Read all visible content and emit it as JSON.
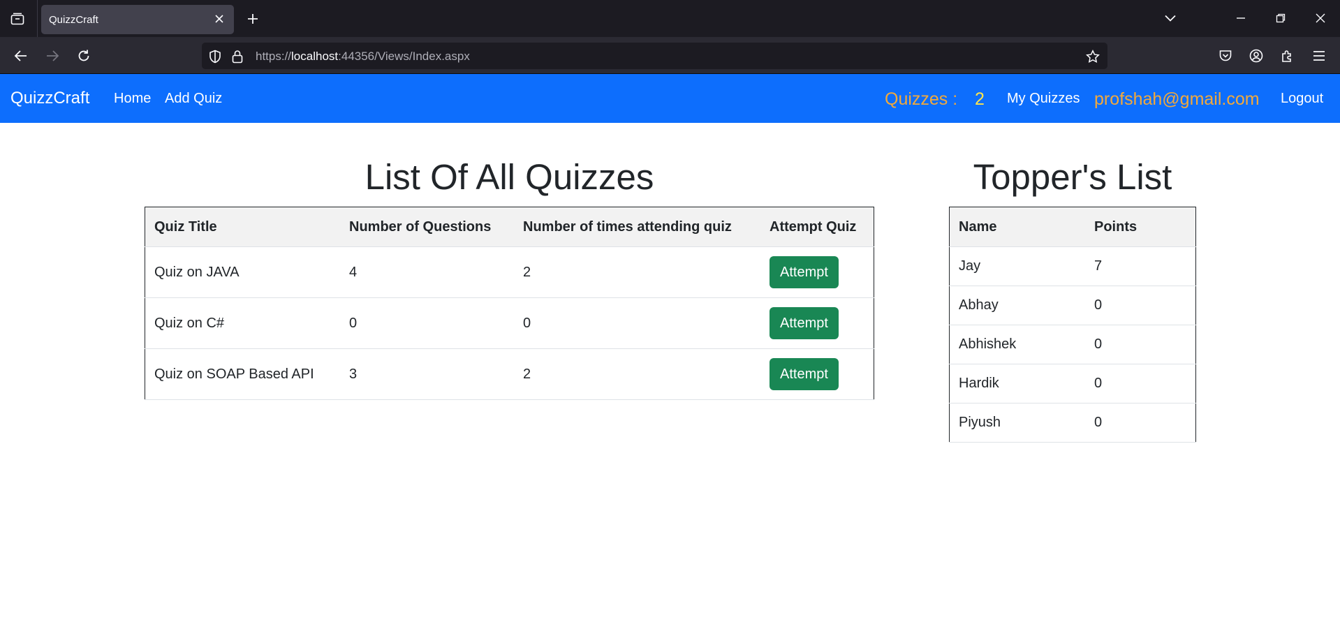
{
  "browser": {
    "tab_title": "QuizzCraft",
    "url_prefix": "https://",
    "url_host": "localhost",
    "url_rest": ":44356/Views/Index.aspx"
  },
  "nav": {
    "brand": "QuizzCraft",
    "home": "Home",
    "add_quiz": "Add Quiz",
    "quizzes_label": "Quizzes :",
    "quizzes_count": "2",
    "my_quizzes": "My Quizzes",
    "email": "profshah@gmail.com",
    "logout": "Logout",
    "colors": {
      "bar": "#0d6efd",
      "accent": "#f2a93b",
      "count": "#ffe44d"
    }
  },
  "quizzes": {
    "heading": "List Of All Quizzes",
    "columns": [
      "Quiz Title",
      "Number of Questions",
      "Number of times attending quiz",
      "Attempt Quiz"
    ],
    "rows": [
      {
        "title": "Quiz on JAVA",
        "questions": "4",
        "attempts": "2",
        "action": "Attempt"
      },
      {
        "title": "Quiz on C#",
        "questions": "0",
        "attempts": "0",
        "action": "Attempt"
      },
      {
        "title": "Quiz on SOAP Based API",
        "questions": "3",
        "attempts": "2",
        "action": "Attempt"
      }
    ]
  },
  "toppers": {
    "heading": "Topper's List",
    "columns": [
      "Name",
      "Points"
    ],
    "rows": [
      {
        "name": "Jay",
        "points": "7"
      },
      {
        "name": "Abhay",
        "points": "0"
      },
      {
        "name": "Abhishek",
        "points": "0"
      },
      {
        "name": "Hardik",
        "points": "0"
      },
      {
        "name": "Piyush",
        "points": "0"
      }
    ]
  }
}
